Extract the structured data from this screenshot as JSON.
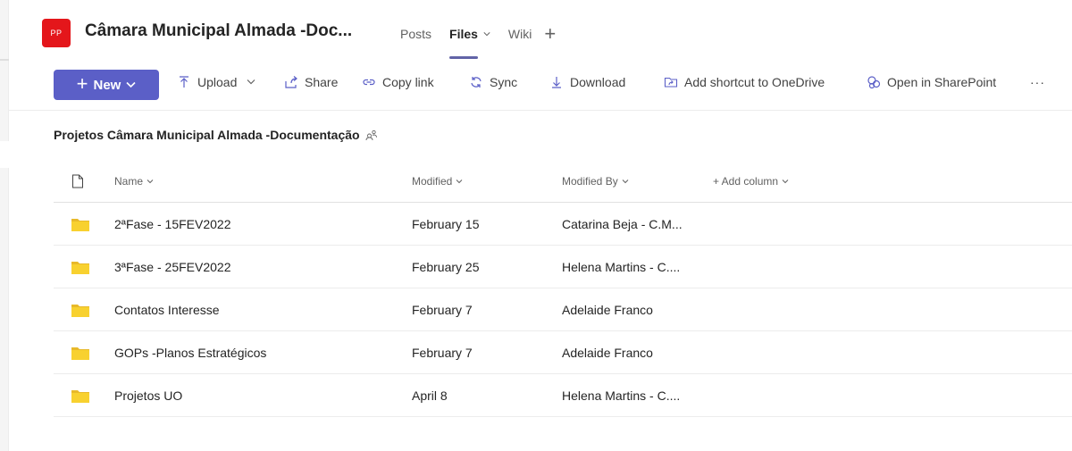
{
  "header": {
    "avatar_initials": "PP",
    "team_title": "Câmara Municipal Almada -Doc...",
    "tabs": [
      {
        "label": "Posts",
        "active": false
      },
      {
        "label": "Files",
        "active": true
      },
      {
        "label": "Wiki",
        "active": false
      }
    ],
    "add_tab_symbol": "+"
  },
  "toolbar": {
    "new_label": "New",
    "upload_label": "Upload",
    "share_label": "Share",
    "copy_link_label": "Copy link",
    "sync_label": "Sync",
    "download_label": "Download",
    "shortcut_label": "Add shortcut to OneDrive",
    "sharepoint_label": "Open in SharePoint",
    "more_symbol": "···"
  },
  "breadcrumb": {
    "title": "Projetos Câmara Municipal Almada -Documentação"
  },
  "table": {
    "headers": {
      "name": "Name",
      "modified": "Modified",
      "modified_by": "Modified By",
      "add_column": "+ Add column"
    },
    "rows": [
      {
        "name": "2ªFase - 15FEV2022",
        "modified": "February 15",
        "modified_by": "Catarina Beja - C.M..."
      },
      {
        "name": "3ªFase - 25FEV2022",
        "modified": "February 25",
        "modified_by": "Helena Martins - C...."
      },
      {
        "name": "Contatos Interesse",
        "modified": "February 7",
        "modified_by": "Adelaide Franco"
      },
      {
        "name": "GOPs -Planos Estratégicos",
        "modified": "February 7",
        "modified_by": "Adelaide Franco"
      },
      {
        "name": "Projetos UO",
        "modified": "April 8",
        "modified_by": "Helena Martins - C...."
      }
    ]
  },
  "colors": {
    "accent": "#5b5fc7",
    "avatar": "#e4161b",
    "folder": "#f8d12f"
  }
}
